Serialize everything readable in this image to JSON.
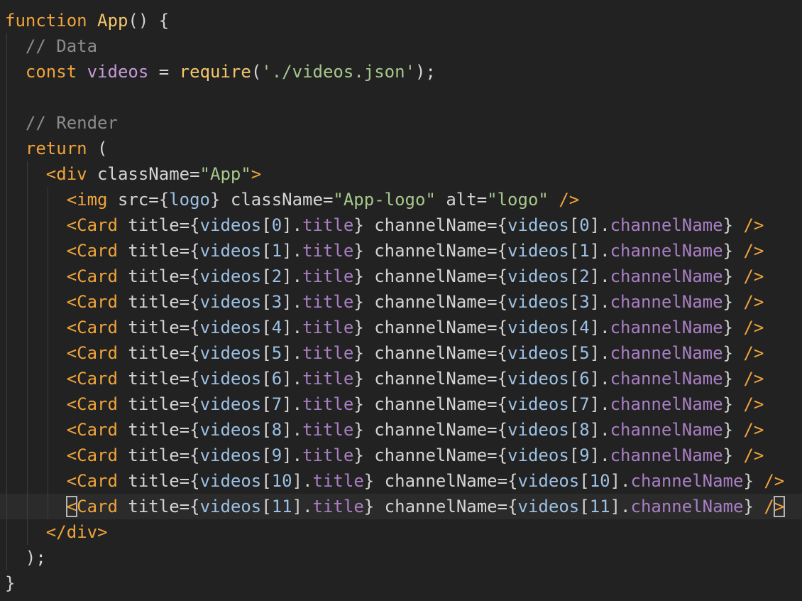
{
  "editor": {
    "lines": [
      [
        [
          "kw",
          "function"
        ],
        [
          "pun",
          " "
        ],
        [
          "fn",
          "App"
        ],
        [
          "pun",
          "() {"
        ]
      ],
      [
        [
          "pun",
          "  "
        ],
        [
          "cmt",
          "// Data"
        ]
      ],
      [
        [
          "pun",
          "  "
        ],
        [
          "kw",
          "const"
        ],
        [
          "pun",
          " "
        ],
        [
          "var",
          "videos"
        ],
        [
          "pun",
          " = "
        ],
        [
          "fn",
          "require"
        ],
        [
          "pun",
          "("
        ],
        [
          "str",
          "'./videos.json'"
        ],
        [
          "pun",
          ");"
        ]
      ],
      [],
      [
        [
          "pun",
          "  "
        ],
        [
          "cmt",
          "// Render"
        ]
      ],
      [
        [
          "pun",
          "  "
        ],
        [
          "kw",
          "return"
        ],
        [
          "pun",
          " ("
        ]
      ],
      [
        [
          "pun",
          "    "
        ],
        [
          "tag",
          "<div"
        ],
        [
          "attr",
          " className="
        ],
        [
          "str",
          "\"App\""
        ],
        [
          "tag",
          ">"
        ]
      ],
      [
        [
          "pun",
          "      "
        ],
        [
          "tag",
          "<img"
        ],
        [
          "attr",
          " src="
        ],
        [
          "pun",
          "{"
        ],
        [
          "expr",
          "logo"
        ],
        [
          "pun",
          "}"
        ],
        [
          "attr",
          " className="
        ],
        [
          "str",
          "\"App-logo\""
        ],
        [
          "attr",
          " alt="
        ],
        [
          "str",
          "\"logo\""
        ],
        [
          "pun",
          " "
        ],
        [
          "tag",
          "/>"
        ]
      ],
      [
        [
          "pun",
          "      "
        ],
        [
          "tag",
          "<Card"
        ],
        [
          "attr",
          " title="
        ],
        [
          "pun",
          "{"
        ],
        [
          "expr",
          "videos"
        ],
        [
          "pun",
          "["
        ],
        [
          "num",
          "0"
        ],
        [
          "pun",
          "]."
        ],
        [
          "prop",
          "title"
        ],
        [
          "pun",
          "}"
        ],
        [
          "attr",
          " channelName="
        ],
        [
          "pun",
          "{"
        ],
        [
          "expr",
          "videos"
        ],
        [
          "pun",
          "["
        ],
        [
          "num",
          "0"
        ],
        [
          "pun",
          "]."
        ],
        [
          "prop",
          "channelName"
        ],
        [
          "pun",
          "}"
        ],
        [
          "pun",
          " "
        ],
        [
          "tag",
          "/>"
        ]
      ],
      [
        [
          "pun",
          "      "
        ],
        [
          "tag",
          "<Card"
        ],
        [
          "attr",
          " title="
        ],
        [
          "pun",
          "{"
        ],
        [
          "expr",
          "videos"
        ],
        [
          "pun",
          "["
        ],
        [
          "num",
          "1"
        ],
        [
          "pun",
          "]."
        ],
        [
          "prop",
          "title"
        ],
        [
          "pun",
          "}"
        ],
        [
          "attr",
          " channelName="
        ],
        [
          "pun",
          "{"
        ],
        [
          "expr",
          "videos"
        ],
        [
          "pun",
          "["
        ],
        [
          "num",
          "1"
        ],
        [
          "pun",
          "]."
        ],
        [
          "prop",
          "channelName"
        ],
        [
          "pun",
          "}"
        ],
        [
          "pun",
          " "
        ],
        [
          "tag",
          "/>"
        ]
      ],
      [
        [
          "pun",
          "      "
        ],
        [
          "tag",
          "<Card"
        ],
        [
          "attr",
          " title="
        ],
        [
          "pun",
          "{"
        ],
        [
          "expr",
          "videos"
        ],
        [
          "pun",
          "["
        ],
        [
          "num",
          "2"
        ],
        [
          "pun",
          "]."
        ],
        [
          "prop",
          "title"
        ],
        [
          "pun",
          "}"
        ],
        [
          "attr",
          " channelName="
        ],
        [
          "pun",
          "{"
        ],
        [
          "expr",
          "videos"
        ],
        [
          "pun",
          "["
        ],
        [
          "num",
          "2"
        ],
        [
          "pun",
          "]."
        ],
        [
          "prop",
          "channelName"
        ],
        [
          "pun",
          "}"
        ],
        [
          "pun",
          " "
        ],
        [
          "tag",
          "/>"
        ]
      ],
      [
        [
          "pun",
          "      "
        ],
        [
          "tag",
          "<Card"
        ],
        [
          "attr",
          " title="
        ],
        [
          "pun",
          "{"
        ],
        [
          "expr",
          "videos"
        ],
        [
          "pun",
          "["
        ],
        [
          "num",
          "3"
        ],
        [
          "pun",
          "]."
        ],
        [
          "prop",
          "title"
        ],
        [
          "pun",
          "}"
        ],
        [
          "attr",
          " channelName="
        ],
        [
          "pun",
          "{"
        ],
        [
          "expr",
          "videos"
        ],
        [
          "pun",
          "["
        ],
        [
          "num",
          "3"
        ],
        [
          "pun",
          "]."
        ],
        [
          "prop",
          "channelName"
        ],
        [
          "pun",
          "}"
        ],
        [
          "pun",
          " "
        ],
        [
          "tag",
          "/>"
        ]
      ],
      [
        [
          "pun",
          "      "
        ],
        [
          "tag",
          "<Card"
        ],
        [
          "attr",
          " title="
        ],
        [
          "pun",
          "{"
        ],
        [
          "expr",
          "videos"
        ],
        [
          "pun",
          "["
        ],
        [
          "num",
          "4"
        ],
        [
          "pun",
          "]."
        ],
        [
          "prop",
          "title"
        ],
        [
          "pun",
          "}"
        ],
        [
          "attr",
          " channelName="
        ],
        [
          "pun",
          "{"
        ],
        [
          "expr",
          "videos"
        ],
        [
          "pun",
          "["
        ],
        [
          "num",
          "4"
        ],
        [
          "pun",
          "]."
        ],
        [
          "prop",
          "channelName"
        ],
        [
          "pun",
          "}"
        ],
        [
          "pun",
          " "
        ],
        [
          "tag",
          "/>"
        ]
      ],
      [
        [
          "pun",
          "      "
        ],
        [
          "tag",
          "<Card"
        ],
        [
          "attr",
          " title="
        ],
        [
          "pun",
          "{"
        ],
        [
          "expr",
          "videos"
        ],
        [
          "pun",
          "["
        ],
        [
          "num",
          "5"
        ],
        [
          "pun",
          "]."
        ],
        [
          "prop",
          "title"
        ],
        [
          "pun",
          "}"
        ],
        [
          "attr",
          " channelName="
        ],
        [
          "pun",
          "{"
        ],
        [
          "expr",
          "videos"
        ],
        [
          "pun",
          "["
        ],
        [
          "num",
          "5"
        ],
        [
          "pun",
          "]."
        ],
        [
          "prop",
          "channelName"
        ],
        [
          "pun",
          "}"
        ],
        [
          "pun",
          " "
        ],
        [
          "tag",
          "/>"
        ]
      ],
      [
        [
          "pun",
          "      "
        ],
        [
          "tag",
          "<Card"
        ],
        [
          "attr",
          " title="
        ],
        [
          "pun",
          "{"
        ],
        [
          "expr",
          "videos"
        ],
        [
          "pun",
          "["
        ],
        [
          "num",
          "6"
        ],
        [
          "pun",
          "]."
        ],
        [
          "prop",
          "title"
        ],
        [
          "pun",
          "}"
        ],
        [
          "attr",
          " channelName="
        ],
        [
          "pun",
          "{"
        ],
        [
          "expr",
          "videos"
        ],
        [
          "pun",
          "["
        ],
        [
          "num",
          "6"
        ],
        [
          "pun",
          "]."
        ],
        [
          "prop",
          "channelName"
        ],
        [
          "pun",
          "}"
        ],
        [
          "pun",
          " "
        ],
        [
          "tag",
          "/>"
        ]
      ],
      [
        [
          "pun",
          "      "
        ],
        [
          "tag",
          "<Card"
        ],
        [
          "attr",
          " title="
        ],
        [
          "pun",
          "{"
        ],
        [
          "expr",
          "videos"
        ],
        [
          "pun",
          "["
        ],
        [
          "num",
          "7"
        ],
        [
          "pun",
          "]."
        ],
        [
          "prop",
          "title"
        ],
        [
          "pun",
          "}"
        ],
        [
          "attr",
          " channelName="
        ],
        [
          "pun",
          "{"
        ],
        [
          "expr",
          "videos"
        ],
        [
          "pun",
          "["
        ],
        [
          "num",
          "7"
        ],
        [
          "pun",
          "]."
        ],
        [
          "prop",
          "channelName"
        ],
        [
          "pun",
          "}"
        ],
        [
          "pun",
          " "
        ],
        [
          "tag",
          "/>"
        ]
      ],
      [
        [
          "pun",
          "      "
        ],
        [
          "tag",
          "<Card"
        ],
        [
          "attr",
          " title="
        ],
        [
          "pun",
          "{"
        ],
        [
          "expr",
          "videos"
        ],
        [
          "pun",
          "["
        ],
        [
          "num",
          "8"
        ],
        [
          "pun",
          "]."
        ],
        [
          "prop",
          "title"
        ],
        [
          "pun",
          "}"
        ],
        [
          "attr",
          " channelName="
        ],
        [
          "pun",
          "{"
        ],
        [
          "expr",
          "videos"
        ],
        [
          "pun",
          "["
        ],
        [
          "num",
          "8"
        ],
        [
          "pun",
          "]."
        ],
        [
          "prop",
          "channelName"
        ],
        [
          "pun",
          "}"
        ],
        [
          "pun",
          " "
        ],
        [
          "tag",
          "/>"
        ]
      ],
      [
        [
          "pun",
          "      "
        ],
        [
          "tag",
          "<Card"
        ],
        [
          "attr",
          " title="
        ],
        [
          "pun",
          "{"
        ],
        [
          "expr",
          "videos"
        ],
        [
          "pun",
          "["
        ],
        [
          "num",
          "9"
        ],
        [
          "pun",
          "]."
        ],
        [
          "prop",
          "title"
        ],
        [
          "pun",
          "}"
        ],
        [
          "attr",
          " channelName="
        ],
        [
          "pun",
          "{"
        ],
        [
          "expr",
          "videos"
        ],
        [
          "pun",
          "["
        ],
        [
          "num",
          "9"
        ],
        [
          "pun",
          "]."
        ],
        [
          "prop",
          "channelName"
        ],
        [
          "pun",
          "}"
        ],
        [
          "pun",
          " "
        ],
        [
          "tag",
          "/>"
        ]
      ],
      [
        [
          "pun",
          "      "
        ],
        [
          "tag",
          "<Card"
        ],
        [
          "attr",
          " title="
        ],
        [
          "pun",
          "{"
        ],
        [
          "expr",
          "videos"
        ],
        [
          "pun",
          "["
        ],
        [
          "num",
          "10"
        ],
        [
          "pun",
          "]."
        ],
        [
          "prop",
          "title"
        ],
        [
          "pun",
          "}"
        ],
        [
          "attr",
          " channelName="
        ],
        [
          "pun",
          "{"
        ],
        [
          "expr",
          "videos"
        ],
        [
          "pun",
          "["
        ],
        [
          "num",
          "10"
        ],
        [
          "pun",
          "]."
        ],
        [
          "prop",
          "channelName"
        ],
        [
          "pun",
          "}"
        ],
        [
          "pun",
          " "
        ],
        [
          "tag",
          "/>"
        ]
      ],
      [
        [
          "pun",
          "      "
        ],
        [
          "tag",
          "<Card"
        ],
        [
          "attr",
          " title="
        ],
        [
          "pun",
          "{"
        ],
        [
          "expr",
          "videos"
        ],
        [
          "pun",
          "["
        ],
        [
          "num",
          "11"
        ],
        [
          "pun",
          "]."
        ],
        [
          "prop",
          "title"
        ],
        [
          "pun",
          "}"
        ],
        [
          "attr",
          " channelName="
        ],
        [
          "pun",
          "{"
        ],
        [
          "expr",
          "videos"
        ],
        [
          "pun",
          "["
        ],
        [
          "num",
          "11"
        ],
        [
          "pun",
          "]."
        ],
        [
          "prop",
          "channelName"
        ],
        [
          "pun",
          "}"
        ],
        [
          "pun",
          " "
        ],
        [
          "tag",
          "/>"
        ]
      ],
      [
        [
          "pun",
          "    "
        ],
        [
          "tag",
          "</div>"
        ]
      ],
      [
        [
          "pun",
          "  );"
        ]
      ],
      [
        [
          "pun",
          "}"
        ]
      ]
    ],
    "current_line": 19
  }
}
